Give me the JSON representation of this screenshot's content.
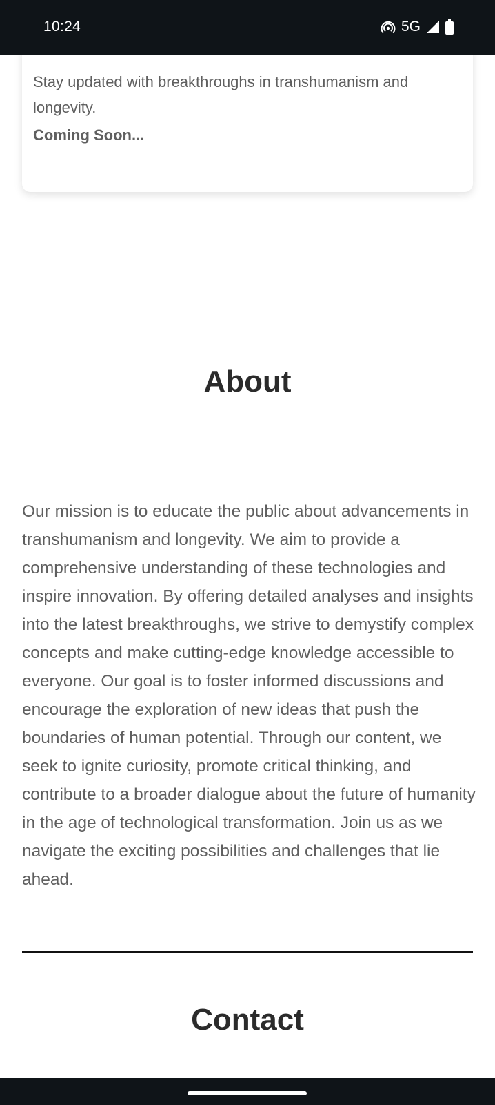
{
  "status_bar": {
    "time": "10:24",
    "network": "5G",
    "icons": [
      "hotspot-icon",
      "signal-icon",
      "battery-icon"
    ]
  },
  "card": {
    "description": "Stay updated with breakthroughs in transhumanism and longevity.",
    "status": "Coming Soon..."
  },
  "about": {
    "title": "About",
    "text": "Our mission is to educate the public about advancements in transhumanism and longevity. We aim to provide a comprehensive understanding of these technologies and inspire innovation. By offering detailed analyses and insights into the latest breakthroughs, we strive to demystify complex concepts and make cutting-edge knowledge accessible to everyone. Our goal is to foster informed discussions and encourage the exploration of new ideas that push the boundaries of human potential. Through our content, we seek to ignite curiosity, promote critical thinking, and contribute to a broader dialogue about the future of humanity in the age of technological transformation. Join us as we navigate the exciting possibilities and challenges that lie ahead."
  },
  "contact": {
    "title": "Contact"
  },
  "colors": {
    "system_bar": "#0f1418",
    "heading": "#2b2b2b",
    "body_text": "#5f5f5f",
    "divider": "#111111"
  }
}
